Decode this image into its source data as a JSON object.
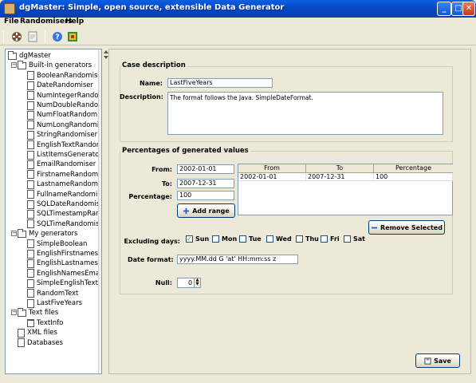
{
  "window": {
    "title": "dgMaster: Simple, open source, extensible Data Generator",
    "minimize": "_",
    "maximize": "□",
    "close": "✕"
  },
  "menu": {
    "file": "File",
    "randomisers": "Randomisers",
    "help": "Help"
  },
  "toolbar": {
    "icons": [
      "open-generator-icon",
      "new-document-icon",
      "help-icon",
      "about-icon"
    ]
  },
  "tree": {
    "root": "dgMaster",
    "builtin_label": "Built-in generators",
    "builtin_items": [
      "BooleanRandomiser",
      "DateRandomiser",
      "NumIntegerRandomise",
      "NumDoubleRandomi",
      "NumFloatRandomise",
      "NumLongRandomise",
      "StringRandomiser",
      "EnglishTextRandomi",
      "ListItemsGenerator",
      "EmailRandomiser",
      "FirstnameRandomise",
      "LastnameRandomise",
      "FullnameRandomise",
      "SQLDateRandomise",
      "SQLTimestampRand",
      "SQLTimeRandomise"
    ],
    "mygen_label": "My generators",
    "mygen_items": [
      "SimpleBoolean",
      "EnglishFirstnames",
      "EnglishLastnames",
      "EnglishNamesEmail",
      "SimpleEnglishText",
      "RandomText",
      "LastFiveYears"
    ],
    "textfiles_label": "Text files",
    "textfiles_items": [
      "TextInfo"
    ],
    "xml_label": "XML files",
    "db_label": "Databases"
  },
  "case": {
    "legend": "Case description",
    "name_label": "Name:",
    "name_value": "LastFiveYears",
    "description_label": "Description:",
    "description_value": "The format follows the Java. SimpleDateFormat."
  },
  "percentages": {
    "legend": "Percentages of generated values",
    "from_label": "From:",
    "from_value": "2002-01-01",
    "to_label": "To:",
    "to_value": "2007-12-31",
    "percentage_label": "Percentage:",
    "percentage_value": "100",
    "add_range": "Add range",
    "table_headers": [
      "From",
      "To",
      "Percentage"
    ],
    "table_rows": [
      [
        "2002-01-01",
        "2007-12-31",
        "100"
      ]
    ],
    "remove_selected": "Remove Selected"
  },
  "excluding": {
    "label": "Excluding days:",
    "days": [
      {
        "label": "Sun",
        "checked": true
      },
      {
        "label": "Mon",
        "checked": false
      },
      {
        "label": "Tue",
        "checked": false
      },
      {
        "label": "Wed",
        "checked": false
      },
      {
        "label": "Thu",
        "checked": false
      },
      {
        "label": "Fri",
        "checked": false
      },
      {
        "label": "Sat",
        "checked": false
      }
    ]
  },
  "date_format": {
    "label": "Date format:",
    "value": "yyyy.MM.dd G 'at' HH:mm:ss z"
  },
  "null_field": {
    "label": "Null:",
    "value": "0"
  },
  "save": "Save"
}
